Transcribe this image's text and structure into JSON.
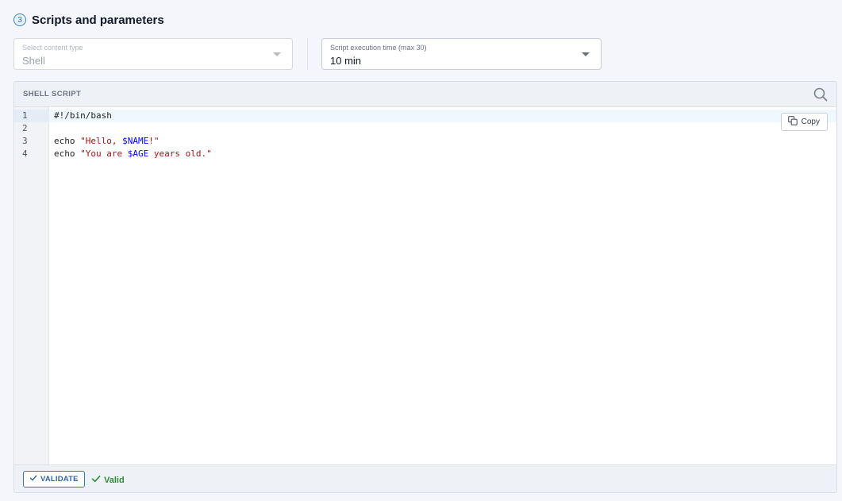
{
  "section": {
    "step": "3",
    "title": "Scripts and parameters"
  },
  "content_type": {
    "label": "Select content type",
    "value": "Shell"
  },
  "exec_time": {
    "label": "Script execution time (max 30)",
    "value": "10 min"
  },
  "editor": {
    "title": "SHELL SCRIPT",
    "copy_label": "Copy",
    "lines": [
      {
        "num": "1",
        "parts": [
          {
            "t": "#!/bin/bash",
            "k": "plain"
          }
        ]
      },
      {
        "num": "2",
        "parts": []
      },
      {
        "num": "3",
        "parts": [
          {
            "t": "echo ",
            "k": "plain"
          },
          {
            "t": "\"Hello, ",
            "k": "str"
          },
          {
            "t": "$NAME",
            "k": "var"
          },
          {
            "t": "!\"",
            "k": "str"
          }
        ]
      },
      {
        "num": "4",
        "parts": [
          {
            "t": "echo ",
            "k": "plain"
          },
          {
            "t": "\"You are ",
            "k": "str"
          },
          {
            "t": "$AGE",
            "k": "var"
          },
          {
            "t": " years old.\"",
            "k": "str"
          }
        ]
      }
    ],
    "active_line": 1
  },
  "footer": {
    "validate_label": "VALIDATE",
    "status_label": "Valid"
  },
  "colors": {
    "accent": "#2f62a8",
    "valid": "#2e8b3a",
    "string": "#a31515",
    "variable": "#0000ff"
  }
}
